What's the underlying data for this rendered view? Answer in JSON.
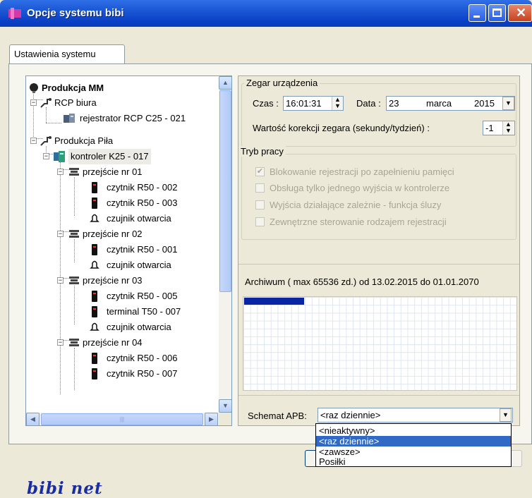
{
  "window": {
    "title": "Opcje systemu bibi"
  },
  "tabs": [
    {
      "label": "Ustawienia systemu"
    }
  ],
  "tree": {
    "root": "Produkcja MM",
    "nodes": {
      "rcp_biura": "RCP biura",
      "rejestrator": "rejestrator RCP C25 - 021",
      "produkcja_pila": "Produkcja Piła",
      "kontroler": "kontroler K25 - 017",
      "przejscie01": "przejście nr 01",
      "czytnik002": "czytnik R50 - 002",
      "czytnik003": "czytnik R50 - 003",
      "czujnik1": "czujnik otwarcia",
      "przejscie02": "przejście nr 02",
      "czytnik001": "czytnik R50 - 001",
      "czujnik2": "czujnik otwarcia",
      "przejscie03": "przejście nr 03",
      "czytnik005": "czytnik R50 - 005",
      "terminal": "terminal T50 - 007",
      "czujnik3": "czujnik otwarcia",
      "przejscie04": "przejście nr 04",
      "czytnik006": "czytnik R50 - 006",
      "czytnik007": "czytnik R50 - 007"
    }
  },
  "clock": {
    "group_title": "Zegar urządzenia",
    "time_label": "Czas :",
    "time_value": "16:01:31",
    "date_label": "Data :",
    "date_day": "23",
    "date_month": "marca",
    "date_year": "2015",
    "correction_label": "Wartość korekcji zegara (sekundy/tydzień) :",
    "correction_value": "-1"
  },
  "mode": {
    "group_title": "Tryb pracy",
    "options": [
      {
        "label": "Blokowanie rejestracji po zapełnieniu pamięci",
        "checked": true
      },
      {
        "label": "Obsługa tylko jednego wyjścia w kontrolerze",
        "checked": false
      },
      {
        "label": "Wyjścia działające zależnie - funkcja śluzy",
        "checked": false
      },
      {
        "label": "Zewnętrzne sterowanie rodzajem rejestracji",
        "checked": false
      }
    ]
  },
  "archive": {
    "label": "Archiwum ( max 65536 zd.) od 13.02.2015 do 01.01.2070",
    "fill_fraction": 0.22
  },
  "apb": {
    "label": "Schemat APB:",
    "value": "<raz dziennie>",
    "options": [
      "<nieaktywny>",
      "<raz dziennie>",
      "<zawsze>",
      "Posiłki"
    ],
    "selected_index": 1
  },
  "logo": "bibi net",
  "colors": {
    "title_bar": "#0a3fc6",
    "selection": "#316ac5",
    "archive_fill": "#0a24a6"
  }
}
